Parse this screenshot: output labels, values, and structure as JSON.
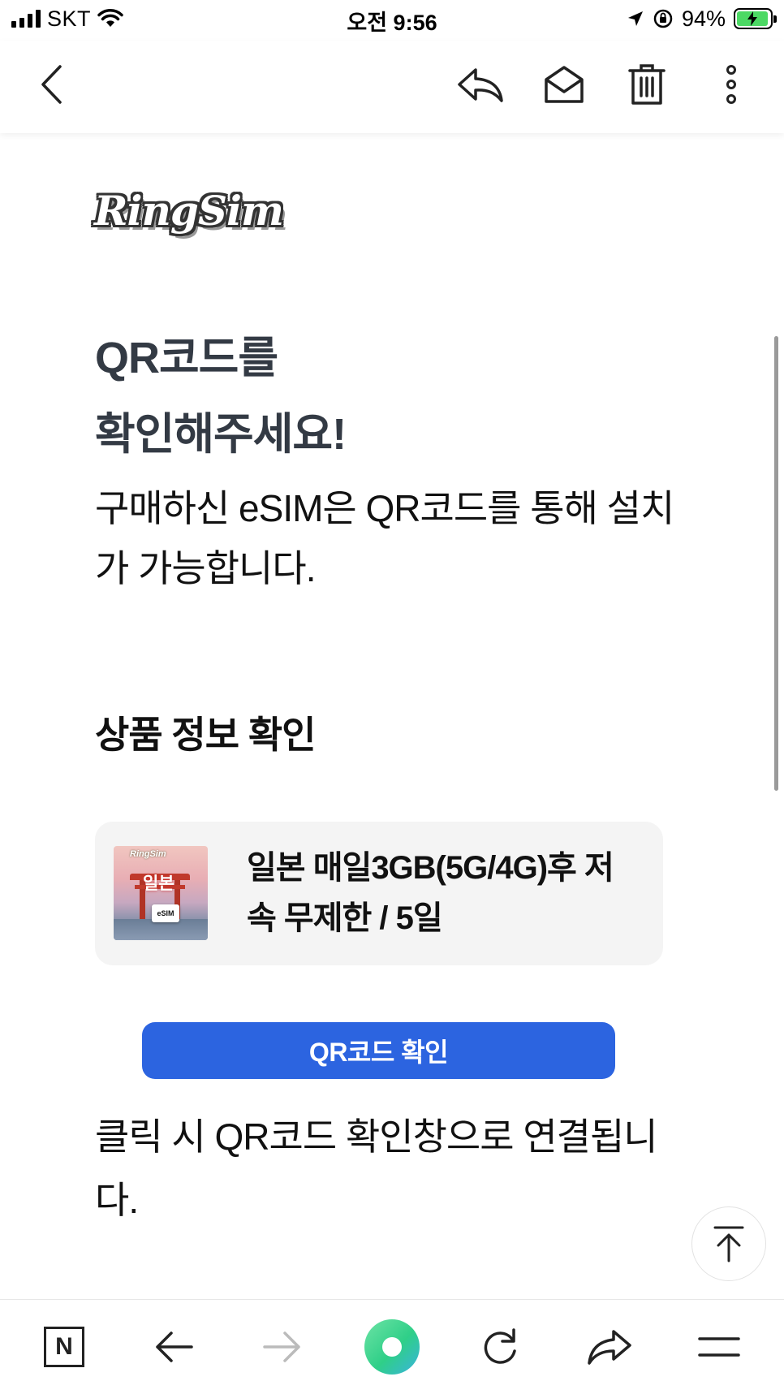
{
  "status_bar": {
    "carrier": "SKT",
    "time": "오전 9:56",
    "battery_text": "94%",
    "battery_level": 0.94,
    "battery_color": "#4cd964"
  },
  "toolbar": {
    "back_icon": "chevron-left-icon",
    "reply_icon": "reply-icon",
    "mark_unread_icon": "envelope-icon",
    "delete_icon": "trash-icon",
    "more_icon": "more-vertical-icon"
  },
  "email": {
    "brand_logo": "RingSim",
    "headline_line1": "QR코드를",
    "headline_line2": "확인해주세요!",
    "description": "구매하신 eSIM은 QR코드를 통해 설치가 가능합니다.",
    "section_title": "상품 정보 확인",
    "product": {
      "thumb_logo": "RingSim",
      "thumb_word": "일본",
      "thumb_card": "eSIM",
      "title": "일본 매일3GB(5G/4G)후 저속 무제한 / 5일"
    },
    "qr_button_label": "QR코드 확인",
    "note": "클릭 시 QR코드 확인창으로 연결됩니다."
  },
  "colors": {
    "accent_button": "#2c64e0",
    "headline": "#333a44",
    "card_bg": "#f4f4f4"
  },
  "bottom_bar": {
    "naver_label": "N",
    "icons": [
      "naver-home-icon",
      "arrow-left-icon",
      "arrow-right-icon",
      "green-dot-icon",
      "reload-icon",
      "share-icon",
      "menu-icon"
    ]
  }
}
